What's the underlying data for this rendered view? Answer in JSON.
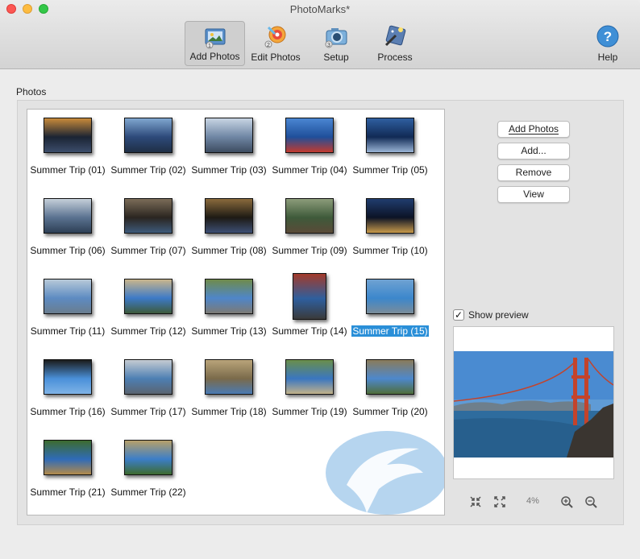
{
  "window": {
    "title": "PhotoMarks*"
  },
  "toolbar": {
    "add_photos": "Add Photos",
    "edit_photos": "Edit Photos",
    "setup": "Setup",
    "process": "Process",
    "help": "Help"
  },
  "photos": {
    "section_label": "Photos",
    "items": [
      {
        "caption": "Summer Trip (01)"
      },
      {
        "caption": "Summer Trip (02)"
      },
      {
        "caption": "Summer Trip (03)"
      },
      {
        "caption": "Summer Trip (04)"
      },
      {
        "caption": "Summer Trip (05)"
      },
      {
        "caption": "Summer Trip (06)"
      },
      {
        "caption": "Summer Trip (07)"
      },
      {
        "caption": "Summer Trip (08)"
      },
      {
        "caption": "Summer Trip (09)"
      },
      {
        "caption": "Summer Trip (10)"
      },
      {
        "caption": "Summer Trip (11)"
      },
      {
        "caption": "Summer Trip (12)"
      },
      {
        "caption": "Summer Trip (13)"
      },
      {
        "caption": "Summer Trip (14)"
      },
      {
        "caption": "Summer Trip (15)",
        "selected": true
      },
      {
        "caption": "Summer Trip (16)"
      },
      {
        "caption": "Summer Trip (17)"
      },
      {
        "caption": "Summer Trip (18)"
      },
      {
        "caption": "Summer Trip (19)"
      },
      {
        "caption": "Summer Trip (20)"
      },
      {
        "caption": "Summer Trip (21)"
      },
      {
        "caption": "Summer Trip (22)"
      }
    ]
  },
  "buttons": {
    "add_photos": "Add Photos",
    "add": "Add...",
    "remove": "Remove",
    "view": "View"
  },
  "preview": {
    "show_preview_label": "Show preview",
    "show_preview_checked": true,
    "zoom_percent": "4%"
  },
  "colors": {
    "selection": "#2a8fd8",
    "watermark": "#9ec7ea"
  }
}
